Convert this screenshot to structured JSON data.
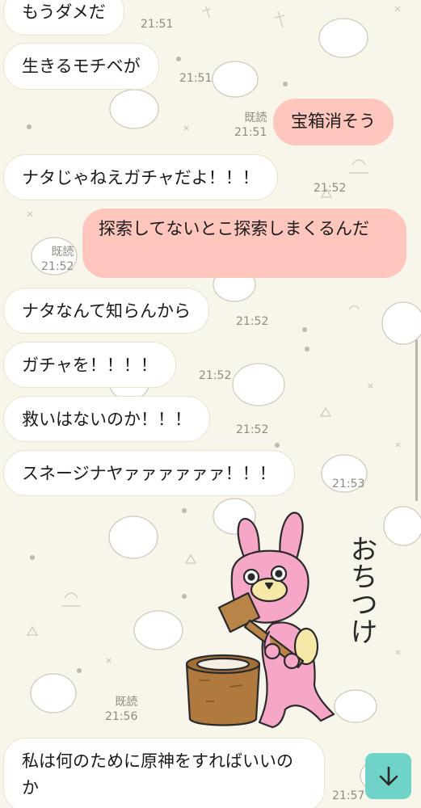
{
  "chat": {
    "read_label": "既読",
    "messages": [
      {
        "id": "m1",
        "side": "in",
        "text": "もうダメだ",
        "time": "21:51"
      },
      {
        "id": "m2",
        "side": "in",
        "text": "生きるモチベが",
        "time": "21:51"
      },
      {
        "id": "m3",
        "side": "out",
        "text": "宝箱消そう",
        "time": "21:51",
        "read": true
      },
      {
        "id": "m4",
        "side": "in",
        "text": "ナタじゃねえガチャだよ！！！",
        "time": "21:52"
      },
      {
        "id": "m5",
        "side": "out",
        "text": "探索してないとこ探索しまくるんだ",
        "time": "21:52",
        "read": true
      },
      {
        "id": "m6",
        "side": "in",
        "text": "ナタなんて知らんから",
        "time": "21:52"
      },
      {
        "id": "m7",
        "side": "in",
        "text": "ガチャを！！！！",
        "time": "21:52"
      },
      {
        "id": "m8",
        "side": "in",
        "text": "救いはないのか！！！",
        "time": "21:52"
      },
      {
        "id": "m9",
        "side": "in",
        "text": "スネージナヤァァァァァァ！！！",
        "time": "21:53"
      },
      {
        "id": "m10",
        "side": "out",
        "type": "sticker",
        "sticker_text": "おちつけ",
        "sticker_icon": "pink-rabbit-mochi-sticker",
        "time": "21:56",
        "read": true
      },
      {
        "id": "m11",
        "side": "in",
        "text": "私は何のために原神をすればいいのか",
        "time": "21:57"
      }
    ]
  },
  "scroll_down_button": {
    "icon": "arrow-down-icon"
  },
  "colors": {
    "background": "#f8f5ea",
    "incoming_bubble": "#ffffff",
    "outgoing_bubble": "#fec6bc",
    "scroll_button": "#6fd3c7"
  }
}
